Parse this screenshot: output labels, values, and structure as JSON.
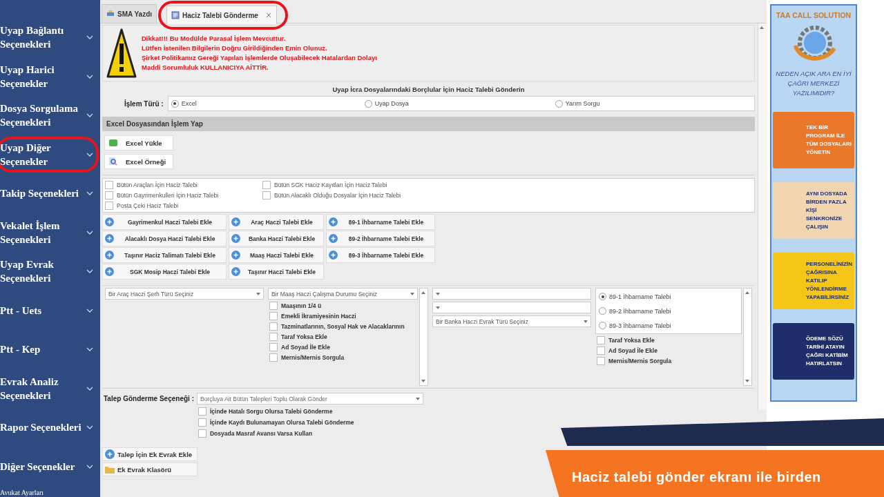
{
  "sidebar": {
    "items": [
      {
        "label": "Uyap Bağlantı Seçenekleri",
        "highlighted": false
      },
      {
        "label": "Uyap Harici Seçenekler",
        "highlighted": false
      },
      {
        "label": "Dosya Sorgulama Seçenekleri",
        "highlighted": false
      },
      {
        "label": "Uyap Diğer Seçenekler",
        "highlighted": true
      },
      {
        "label": "Takip Seçenekleri",
        "highlighted": false
      },
      {
        "label": "Vekalet İşlem Seçenekleri",
        "highlighted": false
      },
      {
        "label": "Uyap Evrak Seçenekleri",
        "highlighted": false
      },
      {
        "label": "Ptt - Uets",
        "highlighted": false
      },
      {
        "label": "Ptt - Kep",
        "highlighted": false
      },
      {
        "label": "Evrak Analiz Seçenekleri",
        "highlighted": false
      },
      {
        "label": "Rapor Seçenekleri",
        "highlighted": false
      },
      {
        "label": "Diğer Seçenekler",
        "highlighted": false
      }
    ],
    "footer": "Avukat Ayarları"
  },
  "tabs": [
    {
      "label": "SMA Yazdı",
      "selected": false,
      "highlighted": false,
      "closable": false
    },
    {
      "label": "Haciz Talebi Gönderme",
      "selected": true,
      "highlighted": true,
      "closable": true
    }
  ],
  "warning": [
    "Dikkat!!! Bu Modülde Parasal İşlem Mevcuttur.",
    "Lütfen İstenilen Bilgilerin Doğru Girildiğinden Emin Olunuz.",
    "Şirket Politikamız Gereği Yapılan İşlemlerde Oluşabilecek Hatalardan Dolayı",
    "Maddi Sorumluluk KULLANICIYA AİTTİR."
  ],
  "form_title": "Uyap İcra Dosyalarındaki Borçlular İçin Haciz Talebi Gönderin",
  "operation_type": {
    "label": "İşlem Türü :",
    "options": [
      {
        "label": "Excel",
        "selected": true
      },
      {
        "label": "Uyap Dosya",
        "selected": false
      },
      {
        "label": "Yarım Sorgu",
        "selected": false
      }
    ]
  },
  "excel_section": {
    "title": "Excel Dosyasından İşlem Yap",
    "buttons": [
      {
        "label": "Excel Yükle",
        "kind": "upload"
      },
      {
        "label": "Excel Örneği",
        "kind": "sample"
      }
    ]
  },
  "bulk_options": [
    {
      "label": "Bütün Araçları İçin Haciz Talebi",
      "checked": false
    },
    {
      "label": "Bütün SGK Haciz Kayıtları İçin Haciz Talebi",
      "checked": false
    },
    {
      "label": "Bütün Gayrimenkulleri İçin Haciz Talebi",
      "checked": false
    },
    {
      "label": "Bütün Alacaklı Olduğu Dosyalar İçin Haciz Talebi",
      "checked": false
    },
    {
      "label": "Posta Çeki Haciz Talebi",
      "checked": false
    }
  ],
  "add_buttons": [
    "Gayrimenkul Haczi Talebi Ekle",
    "Araç Haczi Talebi Ekle",
    "89-1 İhbarname Talebi Ekle",
    "Alacaklı Dosya Haczi Talebi Ekle",
    "Banka Haczi Talebi Ekle",
    "89-2 İhbarname Talebi Ekle",
    "Taşınır Haciz Talimatı Talebi Ekle",
    "Maaş Haczi Talebi Ekle",
    "89-3 İhbarname Talebi Ekle",
    "SGK Mosip Haczi Talebi Ekle",
    "Taşınır Haczi Talebi Ekle"
  ],
  "vehicle_select": {
    "placeholder": "Bir Araç Haczi Şerh Türü Seçiniz"
  },
  "salary": {
    "select": {
      "placeholder": "Bir Maaş Haczi Çalışma Durumu Seçiniz"
    },
    "options": [
      {
        "label": "Maaşının 1/4 ü",
        "checked": false
      },
      {
        "label": "Emekli İkramiyesinin Haczi",
        "checked": false
      },
      {
        "label": "Tazminatlarının, Sosyal Hak ve Alacaklarının",
        "checked": false
      },
      {
        "label": "Taraf Yoksa Ekle",
        "checked": false
      },
      {
        "label": "Ad Soyad İle Ekle",
        "checked": false
      },
      {
        "label": "Mernis/Mernis Sorgula",
        "checked": false
      }
    ]
  },
  "bank": {
    "selects": [
      {
        "kind": "blank"
      },
      {
        "kind": "blank"
      },
      {
        "kind": "text",
        "placeholder": "Bir Banka Haczi Evrak Türü Seçiniz"
      }
    ]
  },
  "notice": {
    "radios": [
      {
        "label": "89-1 İhbarname Talebi",
        "selected": true
      },
      {
        "label": "89-2 İhbarname Talebi",
        "selected": false
      },
      {
        "label": "89-3 İhbarname Talebi",
        "selected": false
      }
    ],
    "options": [
      {
        "label": "Taraf Yoksa Ekle",
        "checked": false
      },
      {
        "label": "Ad Soyad İle Ekle",
        "checked": false
      },
      {
        "label": "Mernis/Mernis Sorgula",
        "checked": false
      }
    ]
  },
  "send_option": {
    "label": "Talep Gönderme Seçeneği :",
    "value": "Borçluya Ait Bütün Talepleri Toplu Olarak Gönder",
    "options": [
      {
        "label": "İçinde Hatalı Sorgu Olursa Talebi Gönderme",
        "checked": false
      },
      {
        "label": "İçinde Kaydı Bulunamayan Olursa Talebi Gönderme",
        "checked": false
      },
      {
        "label": "Dosyada Masraf Avansı Varsa Kullan",
        "checked": false
      }
    ]
  },
  "bottom_buttons": [
    {
      "label": "Talep İçin Ek Evrak Ekle",
      "kind": "add"
    },
    {
      "label": "Ek Evrak Klasörü",
      "kind": "folder"
    }
  ],
  "ad": {
    "brand": "TAA CALL SOLUTION",
    "headline": "NEDEN AÇIK ARA EN İYİ ÇAĞRI MERKEZİ YAZILIMIDIR?",
    "panels": [
      {
        "text": "TEK BİR PROGRAM İLE TÜM DOSYALARI YÖNETİN",
        "color": "#e9782b"
      },
      {
        "text": "AYNI DOSYADA BİRDEN FAZLA KİŞİ SENKRONİZE ÇALIŞIN",
        "color": "#f2d6b0"
      },
      {
        "text": "PERSONELİNİZİN ÇAĞRISINA KATILIP YÖNLENDİRME YAPABİLİRSİNİZ",
        "color": "#f5c518"
      },
      {
        "text": "ÖDEME SÖZÜ TARİHİ ATAYIN ÇAĞRI KATİBİM HATIRLATSIN",
        "color": "#1f2e6b"
      }
    ]
  },
  "caption": "Haciz talebi gönder ekranı ile birden"
}
